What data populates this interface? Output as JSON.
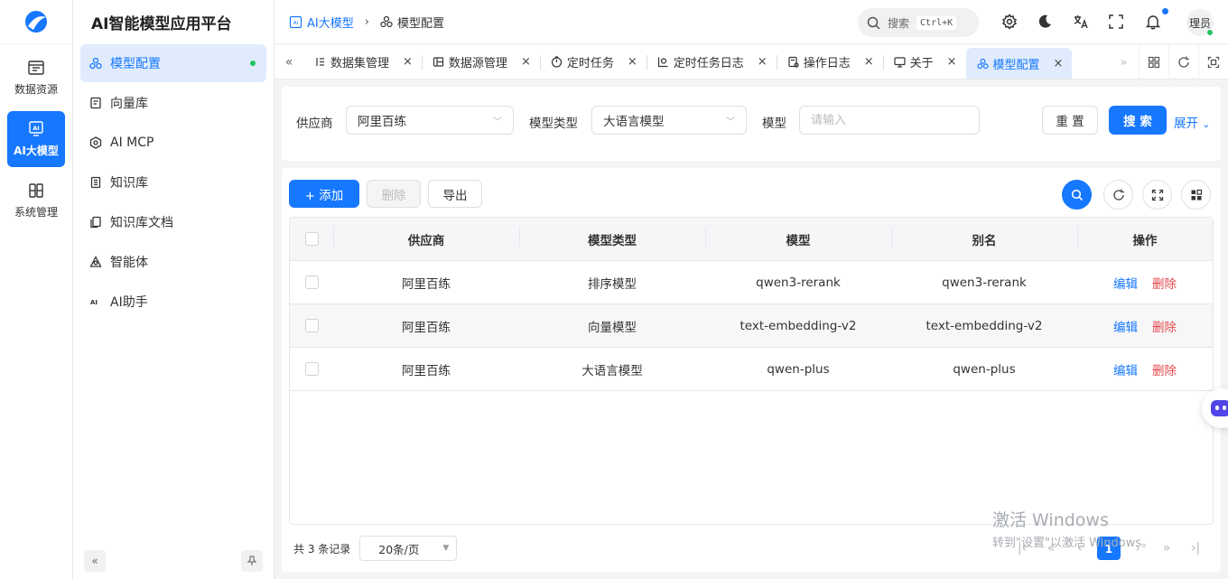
{
  "app": {
    "title": "AI智能模型应用平台"
  },
  "rail": {
    "items": [
      {
        "label": "数据资源",
        "icon": "data-resource-icon"
      },
      {
        "label": "AI大模型",
        "icon": "ai-model-icon",
        "active": true
      },
      {
        "label": "系统管理",
        "icon": "system-icon"
      }
    ]
  },
  "menu": {
    "items": [
      {
        "label": "模型配置",
        "icon": "model-config-icon",
        "active": true
      },
      {
        "label": "向量库",
        "icon": "vector-icon"
      },
      {
        "label": "AI MCP",
        "icon": "mcp-icon"
      },
      {
        "label": "知识库",
        "icon": "knowledge-icon"
      },
      {
        "label": "知识库文档",
        "icon": "docs-icon"
      },
      {
        "label": "智能体",
        "icon": "agent-icon"
      },
      {
        "label": "AI助手",
        "icon": "ai-assistant-icon"
      }
    ],
    "ai_glyph": "AI"
  },
  "header": {
    "breadcrumb": [
      "AI大模型",
      "模型配置"
    ],
    "search_label": "搜索",
    "shortcut": "Ctrl+K",
    "avatar_text": "理员"
  },
  "tabs": {
    "items": [
      {
        "label": "数据集管理"
      },
      {
        "label": "数据源管理"
      },
      {
        "label": "定时任务"
      },
      {
        "label": "定时任务日志"
      },
      {
        "label": "操作日志"
      },
      {
        "label": "关于"
      },
      {
        "label": "模型配置",
        "active": true
      }
    ],
    "close": "×"
  },
  "filter": {
    "provider_label": "供应商",
    "provider_value": "阿里百练",
    "type_label": "模型类型",
    "type_value": "大语言模型",
    "model_label": "模型",
    "model_placeholder": "请输入",
    "reset": "重 置",
    "search": "搜 索",
    "expand": "展开"
  },
  "toolbar": {
    "add": "+ 添加",
    "delete": "删除",
    "export": "导出"
  },
  "table": {
    "columns": [
      "供应商",
      "模型类型",
      "模型",
      "别名",
      "操作"
    ],
    "rows": [
      {
        "provider": "阿里百练",
        "type": "排序模型",
        "model": "qwen3-rerank",
        "alias": "qwen3-rerank"
      },
      {
        "provider": "阿里百练",
        "type": "向量模型",
        "model": "text-embedding-v2",
        "alias": "text-embedding-v2"
      },
      {
        "provider": "阿里百练",
        "type": "大语言模型",
        "model": "qwen-plus",
        "alias": "qwen-plus"
      }
    ],
    "edit": "编辑",
    "remove": "删除"
  },
  "pager": {
    "total": "共 3 条记录",
    "page_size": "20条/页",
    "current": "1"
  },
  "watermark": {
    "line1": "激活 Windows",
    "line2": "转到\"设置\"以激活 Windows。"
  },
  "colors": {
    "primary": "#1677ff",
    "danger": "#e5484d",
    "success": "#22c55e"
  }
}
